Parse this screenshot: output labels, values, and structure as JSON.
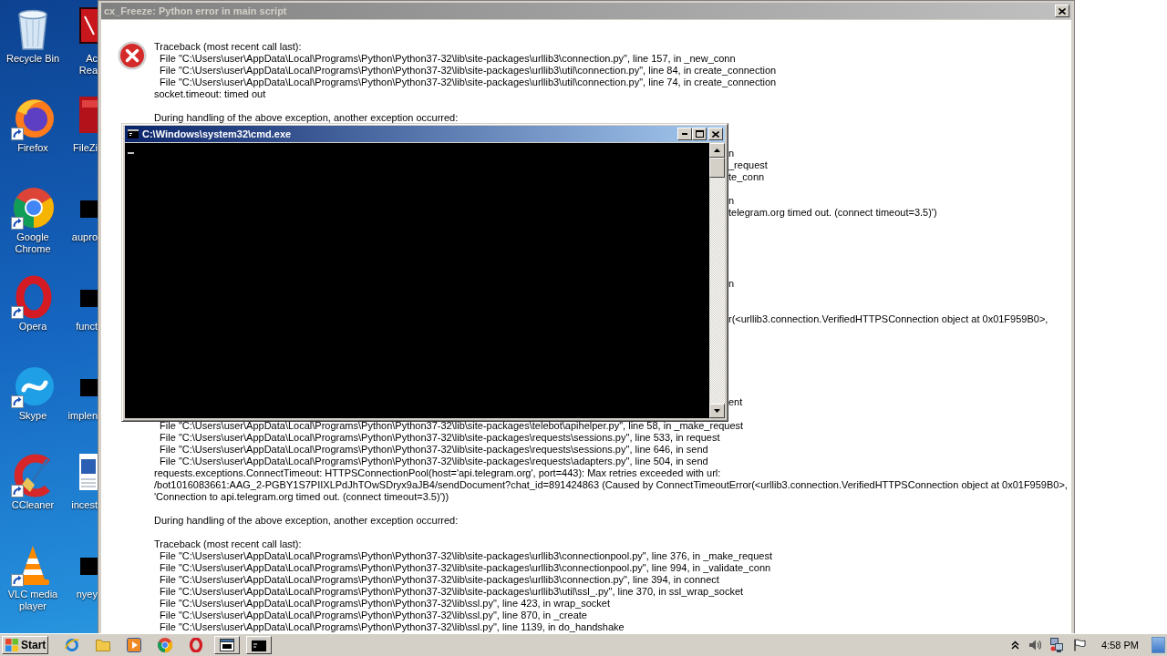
{
  "desktop": {
    "icons": [
      {
        "label": "Recycle Bin"
      },
      {
        "label": "Firefox"
      },
      {
        "label": "Google Chrome"
      },
      {
        "label": "Opera"
      },
      {
        "label": "Skype"
      },
      {
        "label": "CCleaner"
      },
      {
        "label": "VLC media player"
      }
    ],
    "partly_covered_icons": [
      {
        "label": "Ac Rea"
      },
      {
        "label": "FileZi"
      },
      {
        "label": "aupro"
      },
      {
        "label": "funct"
      },
      {
        "label": "implen"
      },
      {
        "label": "incest"
      },
      {
        "label": "nyey"
      }
    ]
  },
  "error_dialog": {
    "title": "cx_Freeze: Python error in main script",
    "text_above_console": [
      [
        "Traceback (most recent call last):",
        "  File \"C:\\Users\\user\\AppData\\Local\\Programs\\Python\\Python37-32\\lib\\site-packages\\urllib3\\connection.py\", line 157, in _new_conn",
        "  File \"C:\\Users\\user\\AppData\\Local\\Programs\\Python\\Python37-32\\lib\\site-packages\\urllib3\\util\\connection.py\", line 84, in create_connection",
        "  File \"C:\\Users\\user\\AppData\\Local\\Programs\\Python\\Python37-32\\lib\\site-packages\\urllib3\\util\\connection.py\", line 74, in create_connection",
        "socket.timeout: timed out"
      ],
      [
        "During handling of the above exception, another exception occurred:"
      ]
    ],
    "text_right_of_console": [
      "n",
      "_request",
      "te_conn",
      "n",
      "telegram.org timed out. (connect timeout=3.5)')",
      "n",
      "r(<urllib3.connection.VerifiedHTTPSConnection object at 0x01F959B0>,",
      "ent"
    ],
    "text_below_console": [
      [
        "  File \"C:\\Users\\user\\AppData\\Local\\Programs\\Python\\Python37-32\\lib\\site-packages\\telebot\\apihelper.py\", line 58, in _make_request",
        "  File \"C:\\Users\\user\\AppData\\Local\\Programs\\Python\\Python37-32\\lib\\site-packages\\requests\\sessions.py\", line 533, in request",
        "  File \"C:\\Users\\user\\AppData\\Local\\Programs\\Python\\Python37-32\\lib\\site-packages\\requests\\sessions.py\", line 646, in send",
        "  File \"C:\\Users\\user\\AppData\\Local\\Programs\\Python\\Python37-32\\lib\\site-packages\\requests\\adapters.py\", line 504, in send",
        "requests.exceptions.ConnectTimeout: HTTPSConnectionPool(host='api.telegram.org', port=443): Max retries exceeded with url:",
        "/bot1016083661:AAG_2-PGBY1S7PIIXLPdJhTOwSDryx9aJB4/sendDocument?chat_id=891424863 (Caused by ConnectTimeoutError(<urllib3.connection.VerifiedHTTPSConnection object at 0x01F959B0>,",
        "'Connection to api.telegram.org timed out. (connect timeout=3.5)'))"
      ],
      [
        "During handling of the above exception, another exception occurred:"
      ],
      [
        "Traceback (most recent call last):",
        "  File \"C:\\Users\\user\\AppData\\Local\\Programs\\Python\\Python37-32\\lib\\site-packages\\urllib3\\connectionpool.py\", line 376, in _make_request",
        "  File \"C:\\Users\\user\\AppData\\Local\\Programs\\Python\\Python37-32\\lib\\site-packages\\urllib3\\connectionpool.py\", line 994, in _validate_conn",
        "  File \"C:\\Users\\user\\AppData\\Local\\Programs\\Python\\Python37-32\\lib\\site-packages\\urllib3\\connection.py\", line 394, in connect",
        "  File \"C:\\Users\\user\\AppData\\Local\\Programs\\Python\\Python37-32\\lib\\site-packages\\urllib3\\util\\ssl_.py\", line 370, in ssl_wrap_socket",
        "  File \"C:\\Users\\user\\AppData\\Local\\Programs\\Python\\Python37-32\\lib\\ssl.py\", line 423, in wrap_socket",
        "  File \"C:\\Users\\user\\AppData\\Local\\Programs\\Python\\Python37-32\\lib\\ssl.py\", line 870, in _create",
        "  File \"C:\\Users\\user\\AppData\\Local\\Programs\\Python\\Python37-32\\lib\\ssl.py\", line 1139, in do_handshake"
      ]
    ]
  },
  "console_window": {
    "title": "C:\\Windows\\system32\\cmd.exe"
  },
  "taskbar": {
    "start_label": "Start",
    "clock": "4:58 PM"
  }
}
